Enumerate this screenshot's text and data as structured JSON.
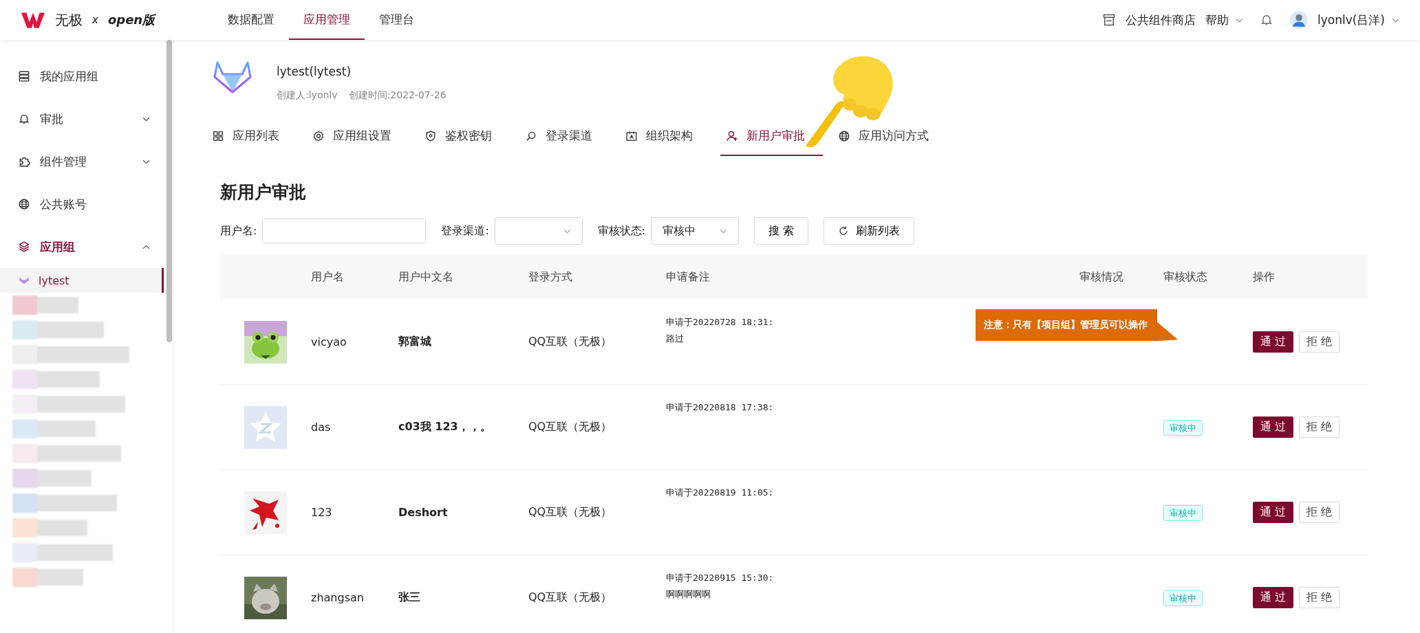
{
  "top_bar": {
    "brand": "无极",
    "brand_separator": "x",
    "brand_edition": "open版",
    "nav": [
      {
        "label": "数据配置",
        "selected": false
      },
      {
        "label": "应用管理",
        "selected": true
      },
      {
        "label": "管理台",
        "selected": false
      }
    ],
    "store": "公共组件商店",
    "help": "帮助",
    "user": "lyonlv(吕洋)"
  },
  "sidebar": {
    "items": [
      {
        "label": "我的应用组",
        "kind": "link",
        "selected": false
      },
      {
        "label": "审批",
        "kind": "group",
        "expanded": false,
        "selected": false
      },
      {
        "label": "组件管理",
        "kind": "group",
        "expanded": false,
        "selected": false
      },
      {
        "label": "公共账号",
        "kind": "link",
        "selected": false
      },
      {
        "label": "应用组",
        "kind": "group",
        "expanded": true,
        "selected": true,
        "children": [
          {
            "label": "lytest",
            "selected": true
          }
        ]
      }
    ],
    "blurred_items": [
      {
        "color": "#f0c8cf"
      },
      {
        "color": "#d8ecef"
      },
      {
        "color": "#eeeeee"
      },
      {
        "color": "#efe2f3"
      },
      {
        "color": "#f3eef3"
      },
      {
        "color": "#dbe8f6"
      },
      {
        "color": "#f6eaf0"
      },
      {
        "color": "#e5d8ec"
      },
      {
        "color": "#d3e2f3"
      },
      {
        "color": "#fbe3d6"
      },
      {
        "color": "#e8edf6"
      },
      {
        "color": "#f8d8d0"
      }
    ]
  },
  "project": {
    "name": "lytest(lytest)",
    "creator": "创建人:lyonlv",
    "created": "创建时间:2022-07-26"
  },
  "tabs": [
    {
      "label": "应用列表",
      "selected": false
    },
    {
      "label": "应用组设置",
      "selected": false
    },
    {
      "label": "鉴权密钥",
      "selected": false
    },
    {
      "label": "登录渠道",
      "selected": false
    },
    {
      "label": "组织架构",
      "selected": false
    },
    {
      "label": "新用户审批",
      "selected": true
    },
    {
      "label": "应用访问方式",
      "selected": false
    }
  ],
  "heading": "新用户审批",
  "filters": {
    "username_label": "用户名:",
    "channel_label": "登录渠道:",
    "status_label": "审核状态:",
    "status_value": "审核中",
    "search_button": "搜 索",
    "refresh_button": "刷新列表"
  },
  "table": {
    "columns": [
      "用户名",
      "用户中文名",
      "登录方式",
      "申请备注",
      "审核情况",
      "审核状态",
      "操作"
    ],
    "rows": [
      {
        "username": "vicyao",
        "cn_name": "郭富城",
        "login": "QQ互联（无极）",
        "remark": "申请于20220728 18:31:",
        "remark_note": "路过",
        "approve": "通 过",
        "reject": "拒 绝"
      },
      {
        "username": "das",
        "cn_name": "c03我 123，，。",
        "login": "QQ互联（无极）",
        "remark": "申请于20220818 17:38:",
        "status": "审核中",
        "approve": "通 过",
        "reject": "拒 绝"
      },
      {
        "username": "123",
        "cn_name": "Deshort",
        "login": "QQ互联（无极）",
        "remark": "申请于20220819 11:05:",
        "status": "审核中",
        "approve": "通 过",
        "reject": "拒 绝"
      },
      {
        "username": "zhangsan",
        "cn_name": "张三",
        "login": "QQ互联（无极）",
        "remark": "申请于20220915 15:30:",
        "remark_note": "啊啊啊啊啊",
        "status": "审核中",
        "approve": "通 过",
        "reject": "拒 绝"
      }
    ]
  },
  "callout": {
    "text": "注意：只有【项目组】管理员可以操作"
  }
}
